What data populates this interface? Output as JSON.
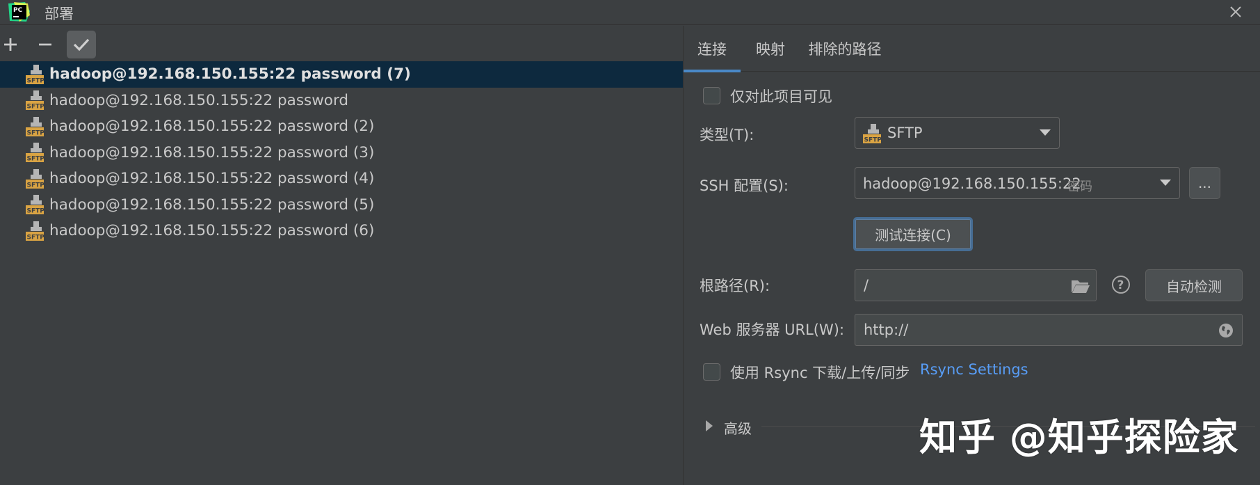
{
  "window": {
    "title": "部署",
    "logo_text": "PC"
  },
  "toolbar": {
    "add": "add-icon",
    "remove": "remove-icon",
    "default": "check-icon"
  },
  "servers": [
    {
      "label": "hadoop@192.168.150.155:22 password (7)",
      "icon_text": "SFTP",
      "selected": true
    },
    {
      "label": "hadoop@192.168.150.155:22 password",
      "icon_text": "SFTP",
      "selected": false
    },
    {
      "label": "hadoop@192.168.150.155:22 password (2)",
      "icon_text": "SFTP",
      "selected": false
    },
    {
      "label": "hadoop@192.168.150.155:22 password (3)",
      "icon_text": "SFTP",
      "selected": false
    },
    {
      "label": "hadoop@192.168.150.155:22 password (4)",
      "icon_text": "SFTP",
      "selected": false
    },
    {
      "label": "hadoop@192.168.150.155:22 password (5)",
      "icon_text": "SFTP",
      "selected": false
    },
    {
      "label": "hadoop@192.168.150.155:22 password (6)",
      "icon_text": "SFTP",
      "selected": false
    }
  ],
  "tabs": [
    {
      "label": "连接",
      "active": true
    },
    {
      "label": "映射",
      "active": false
    },
    {
      "label": "排除的路径",
      "active": false
    }
  ],
  "form": {
    "visible_only_label": "仅对此项目可见",
    "type_label": "类型(T):",
    "type_value": "SFTP",
    "type_icon_text": "SFTP",
    "ssh_label": "SSH 配置(S):",
    "ssh_value": "hadoop@192.168.150.155:22",
    "ssh_hint": "密码",
    "ssh_more": "...",
    "test_button": "测试连接(C)",
    "root_label": "根路径(R):",
    "root_value": "/",
    "autodetect_button": "自动检测",
    "web_label": "Web 服务器 URL(W):",
    "web_value": "http://",
    "rsync_label": "使用 Rsync 下载/上传/同步",
    "rsync_link": "Rsync Settings",
    "advanced_label": "高级"
  },
  "watermark": "知乎 @知乎探险家",
  "colors": {
    "background": "#3c3f41",
    "selection": "#0d293e",
    "accent": "#4a88c7",
    "link": "#589df6",
    "sftp_icon": "#d9a343"
  }
}
